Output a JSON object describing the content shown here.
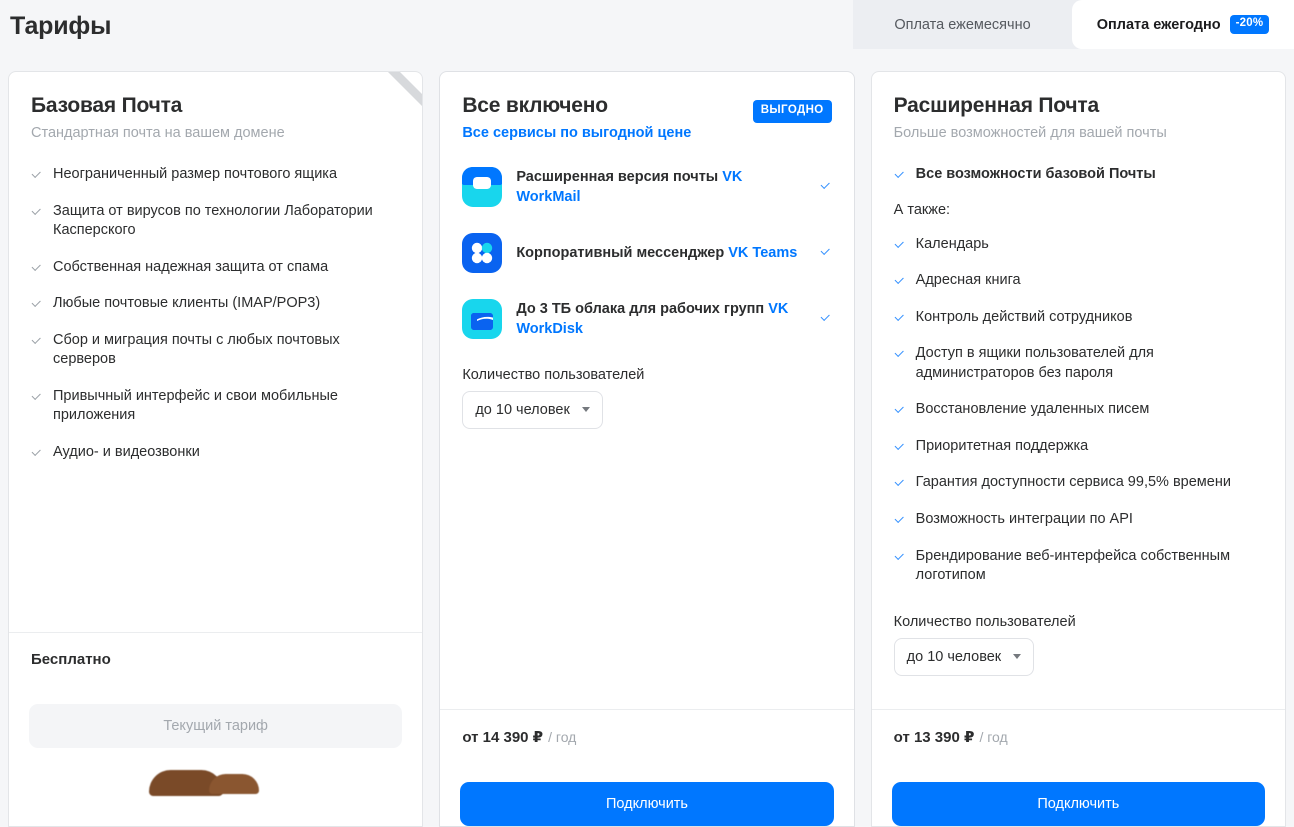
{
  "header": {
    "title": "Тарифы",
    "billing_toggle": {
      "monthly_label": "Оплата ежемесячно",
      "yearly_label": "Оплата ежегодно",
      "yearly_badge": "-20%",
      "active": "yearly"
    }
  },
  "colors": {
    "accent": "#0077ff",
    "page_bg": "#f5f6f8",
    "toggle_track": "#eceef2",
    "muted_text": "#a3a8ae",
    "text": "#2c2d2e"
  },
  "cards": [
    {
      "title": "Базовая Почта",
      "subtitle": "Стандартная почта на вашем домене",
      "features": [
        "Неограниченный размер почтового ящика",
        "Защита от вирусов по технологии Лаборатории Касперского",
        "Собственная надежная защита от спама",
        "Любые почтовые клиенты (IMAP/POP3)",
        "Сбор и миграция почты с любых почтовых серверов",
        "Привычный интерфейс и свои мобильные приложения",
        "Аудио- и видеозвонки"
      ],
      "price_main": "Бесплатно",
      "price_period": "",
      "cta_label": "Текущий тариф",
      "cta_state": "disabled"
    },
    {
      "title": "Все включено",
      "subtitle": "Все сервисы по выгодной цене",
      "ribbon": "ВЫГОДНО",
      "services": [
        {
          "icon": "vk-workmail-icon",
          "text": "Расширенная версия почты ",
          "brand": "VK WorkMail"
        },
        {
          "icon": "vk-teams-icon",
          "text": "Корпоративный мессенджер ",
          "brand": "VK Teams"
        },
        {
          "icon": "vk-workdisk-icon",
          "text": "До 3 ТБ облака для рабочих групп ",
          "brand": "VK WorkDisk"
        }
      ],
      "users_label": "Количество пользователей",
      "users_value": "до 10 человек",
      "price_main": "от 14 390 ₽",
      "price_period": "/ год",
      "cta_label": "Подключить",
      "cta_state": "primary"
    },
    {
      "title": "Расширенная Почта",
      "subtitle": "Больше возможностей для вашей почты",
      "highlight_feature": "Все возможности базовой Почты",
      "also_label": "А также:",
      "features": [
        "Календарь",
        "Адресная книга",
        "Контроль действий сотрудников",
        "Доступ в ящики пользователей для администраторов без пароля",
        "Восстановление удаленных писем",
        "Приоритетная поддержка",
        "Гарантия доступности сервиса 99,5% времени",
        "Возможность интеграции по API",
        "Брендирование веб-интерфейса собственным логотипом"
      ],
      "users_label": "Количество пользователей",
      "users_value": "до 10 человек",
      "price_main": "от 13 390 ₽",
      "price_period": "/ год",
      "cta_label": "Подключить",
      "cta_state": "primary"
    }
  ]
}
